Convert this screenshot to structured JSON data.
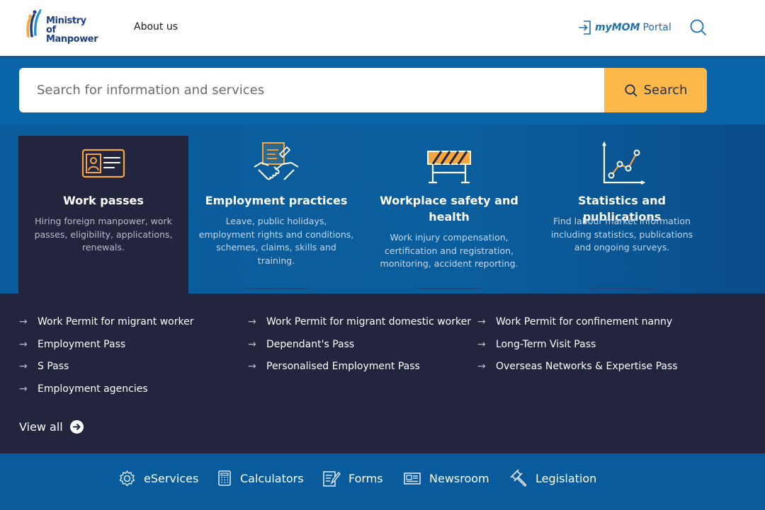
{
  "header": {
    "logo_line1": "Ministry of",
    "logo_line2": "Manpower",
    "about_label": "About us",
    "portal_prefix": "myMOM",
    "portal_suffix": "Portal"
  },
  "search": {
    "placeholder": "Search for information and services",
    "button_label": "Search"
  },
  "categories": [
    {
      "title": "Work passes",
      "desc": "Hiring foreign manpower, work passes, eligibility, applications, renewals.",
      "icon": "id-card-icon",
      "active": true
    },
    {
      "title": "Employment practices",
      "desc": "Leave, public holidays, employment rights and conditions, schemes, claims, skills and training.",
      "icon": "handshake-icon",
      "active": false
    },
    {
      "title": "Workplace safety and health",
      "desc": "Work injury compensation, certification and registration, monitoring, accident reporting.",
      "icon": "barrier-icon",
      "active": false
    },
    {
      "title": "Statistics and publications",
      "desc": "Find labour market information including statistics, publications and ongoing surveys.",
      "icon": "line-chart-icon",
      "active": false
    }
  ],
  "links": {
    "col1": [
      "Work Permit for migrant worker",
      "Employment Pass",
      "S Pass",
      "Employment agencies"
    ],
    "col2": [
      "Work Permit for migrant domestic worker",
      "Dependant's Pass",
      "Personalised Employment Pass"
    ],
    "col3": [
      "Work Permit for confinement nanny",
      "Long-Term Visit Pass",
      "Overseas Networks & Expertise Pass"
    ],
    "view_all": "View all"
  },
  "quick_links": [
    {
      "label": "eServices",
      "icon": "gear-icon"
    },
    {
      "label": "Calculators",
      "icon": "calculator-icon"
    },
    {
      "label": "Forms",
      "icon": "form-icon"
    },
    {
      "label": "Newsroom",
      "icon": "newspaper-icon"
    },
    {
      "label": "Legislation",
      "icon": "gavel-icon"
    }
  ],
  "colors": {
    "brand_blue": "#1d3f87",
    "accent_yellow": "#fdb84a",
    "dark_panel": "#23253f",
    "band_blue": "#0a5b9c",
    "icon_orange": "#f7a63c"
  }
}
